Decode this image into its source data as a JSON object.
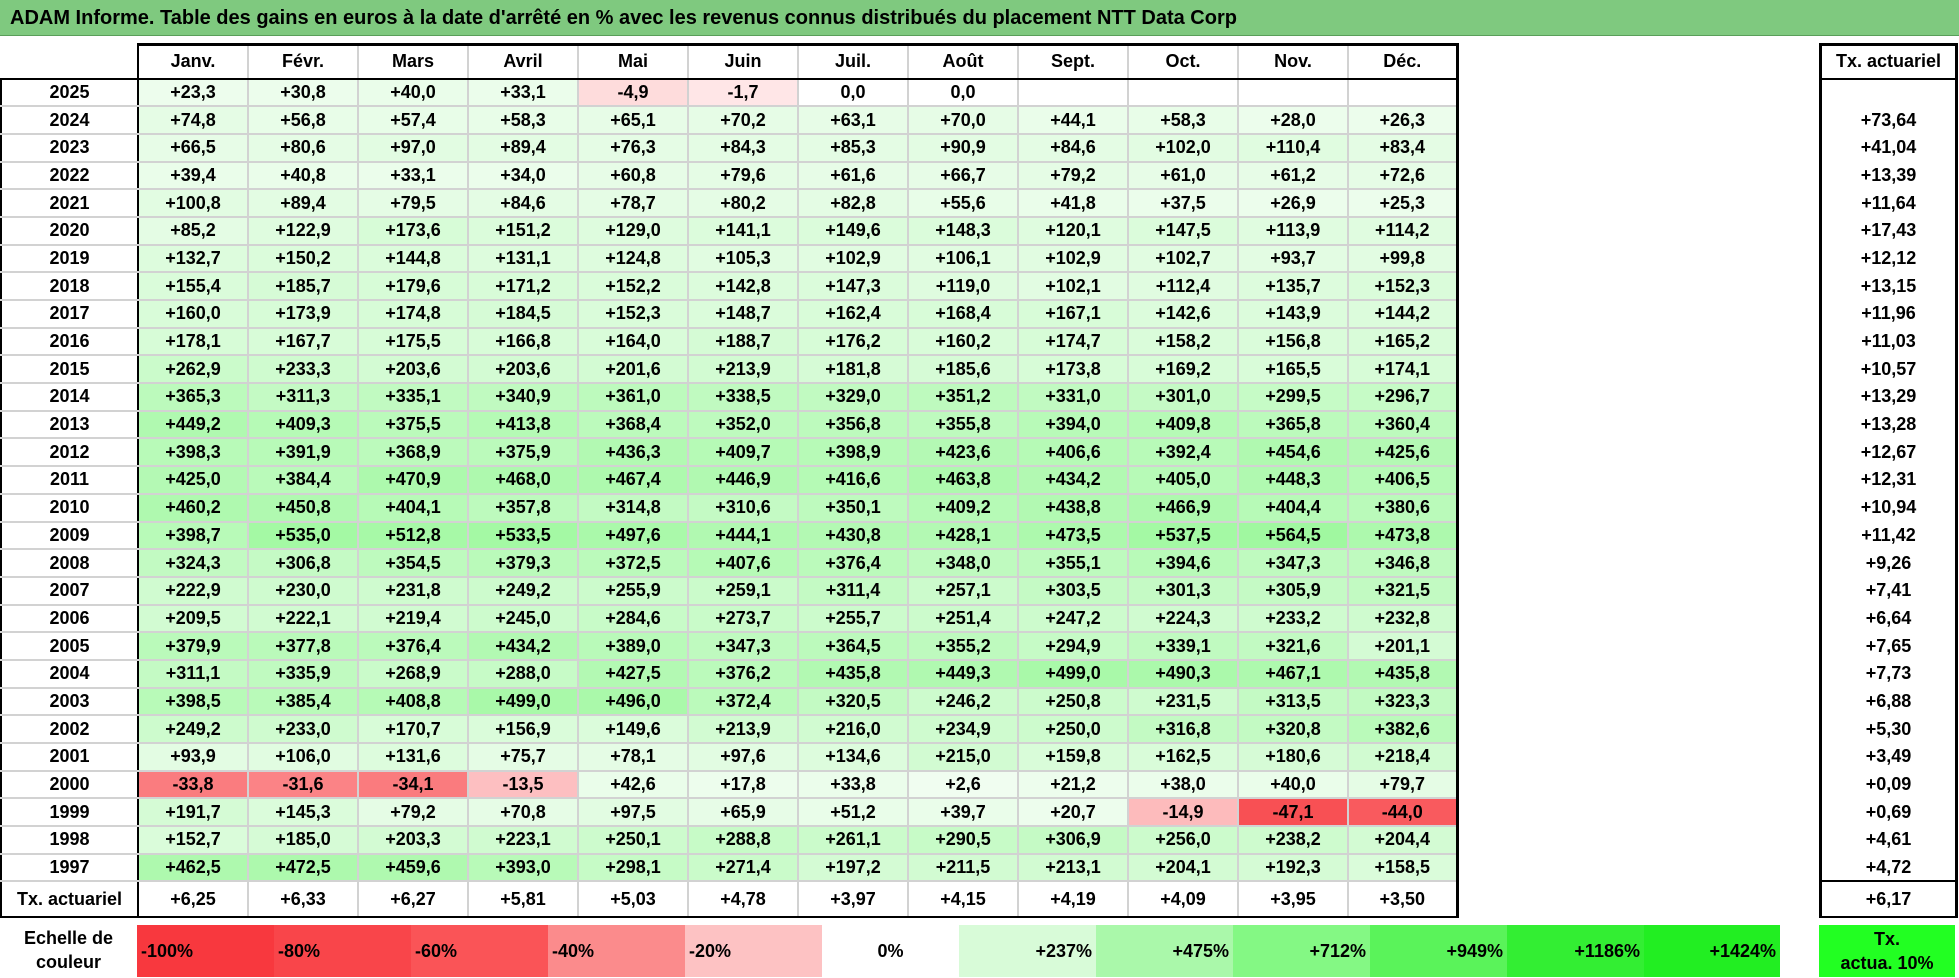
{
  "title": "ADAM Informe. Table des gains en euros à la date d'arrêté en % avec les revenus connus distribués du placement NTT Data Corp",
  "months": [
    "Janv.",
    "Févr.",
    "Mars",
    "Avril",
    "Mai",
    "Juin",
    "Juil.",
    "Août",
    "Sept.",
    "Oct.",
    "Nov.",
    "Déc."
  ],
  "act_header": "Tx. actuariel",
  "rows": [
    {
      "year": "2025",
      "vals": [
        "+23,3",
        "+30,8",
        "+40,0",
        "+33,1",
        "-4,9",
        "-1,7",
        "0,0",
        "0,0",
        "",
        "",
        "",
        ""
      ],
      "act": ""
    },
    {
      "year": "2024",
      "vals": [
        "+74,8",
        "+56,8",
        "+57,4",
        "+58,3",
        "+65,1",
        "+70,2",
        "+63,1",
        "+70,0",
        "+44,1",
        "+58,3",
        "+28,0",
        "+26,3"
      ],
      "act": "+73,64"
    },
    {
      "year": "2023",
      "vals": [
        "+66,5",
        "+80,6",
        "+97,0",
        "+89,4",
        "+76,3",
        "+84,3",
        "+85,3",
        "+90,9",
        "+84,6",
        "+102,0",
        "+110,4",
        "+83,4"
      ],
      "act": "+41,04"
    },
    {
      "year": "2022",
      "vals": [
        "+39,4",
        "+40,8",
        "+33,1",
        "+34,0",
        "+60,8",
        "+79,6",
        "+61,6",
        "+66,7",
        "+79,2",
        "+61,0",
        "+61,2",
        "+72,6"
      ],
      "act": "+13,39"
    },
    {
      "year": "2021",
      "vals": [
        "+100,8",
        "+89,4",
        "+79,5",
        "+84,6",
        "+78,7",
        "+80,2",
        "+82,8",
        "+55,6",
        "+41,8",
        "+37,5",
        "+26,9",
        "+25,3"
      ],
      "act": "+11,64"
    },
    {
      "year": "2020",
      "vals": [
        "+85,2",
        "+122,9",
        "+173,6",
        "+151,2",
        "+129,0",
        "+141,1",
        "+149,6",
        "+148,3",
        "+120,1",
        "+147,5",
        "+113,9",
        "+114,2"
      ],
      "act": "+17,43"
    },
    {
      "year": "2019",
      "vals": [
        "+132,7",
        "+150,2",
        "+144,8",
        "+131,1",
        "+124,8",
        "+105,3",
        "+102,9",
        "+106,1",
        "+102,9",
        "+102,7",
        "+93,7",
        "+99,8"
      ],
      "act": "+12,12"
    },
    {
      "year": "2018",
      "vals": [
        "+155,4",
        "+185,7",
        "+179,6",
        "+171,2",
        "+152,2",
        "+142,8",
        "+147,3",
        "+119,0",
        "+102,1",
        "+112,4",
        "+135,7",
        "+152,3"
      ],
      "act": "+13,15"
    },
    {
      "year": "2017",
      "vals": [
        "+160,0",
        "+173,9",
        "+174,8",
        "+184,5",
        "+152,3",
        "+148,7",
        "+162,4",
        "+168,4",
        "+167,1",
        "+142,6",
        "+143,9",
        "+144,2"
      ],
      "act": "+11,96"
    },
    {
      "year": "2016",
      "vals": [
        "+178,1",
        "+167,7",
        "+175,5",
        "+166,8",
        "+164,0",
        "+188,7",
        "+176,2",
        "+160,2",
        "+174,7",
        "+158,2",
        "+156,8",
        "+165,2"
      ],
      "act": "+11,03"
    },
    {
      "year": "2015",
      "vals": [
        "+262,9",
        "+233,3",
        "+203,6",
        "+203,6",
        "+201,6",
        "+213,9",
        "+181,8",
        "+185,6",
        "+173,8",
        "+169,2",
        "+165,5",
        "+174,1"
      ],
      "act": "+10,57"
    },
    {
      "year": "2014",
      "vals": [
        "+365,3",
        "+311,3",
        "+335,1",
        "+340,9",
        "+361,0",
        "+338,5",
        "+329,0",
        "+351,2",
        "+331,0",
        "+301,0",
        "+299,5",
        "+296,7"
      ],
      "act": "+13,29"
    },
    {
      "year": "2013",
      "vals": [
        "+449,2",
        "+409,3",
        "+375,5",
        "+413,8",
        "+368,4",
        "+352,0",
        "+356,8",
        "+355,8",
        "+394,0",
        "+409,8",
        "+365,8",
        "+360,4"
      ],
      "act": "+13,28"
    },
    {
      "year": "2012",
      "vals": [
        "+398,3",
        "+391,9",
        "+368,9",
        "+375,9",
        "+436,3",
        "+409,7",
        "+398,9",
        "+423,6",
        "+406,6",
        "+392,4",
        "+454,6",
        "+425,6"
      ],
      "act": "+12,67"
    },
    {
      "year": "2011",
      "vals": [
        "+425,0",
        "+384,4",
        "+470,9",
        "+468,0",
        "+467,4",
        "+446,9",
        "+416,6",
        "+463,8",
        "+434,2",
        "+405,0",
        "+448,3",
        "+406,5"
      ],
      "act": "+12,31"
    },
    {
      "year": "2010",
      "vals": [
        "+460,2",
        "+450,8",
        "+404,1",
        "+357,8",
        "+314,8",
        "+310,6",
        "+350,1",
        "+409,2",
        "+438,8",
        "+466,9",
        "+404,4",
        "+380,6"
      ],
      "act": "+10,94"
    },
    {
      "year": "2009",
      "vals": [
        "+398,7",
        "+535,0",
        "+512,8",
        "+533,5",
        "+497,6",
        "+444,1",
        "+430,8",
        "+428,1",
        "+473,5",
        "+537,5",
        "+564,5",
        "+473,8"
      ],
      "act": "+11,42"
    },
    {
      "year": "2008",
      "vals": [
        "+324,3",
        "+306,8",
        "+354,5",
        "+379,3",
        "+372,5",
        "+407,6",
        "+376,4",
        "+348,0",
        "+355,1",
        "+394,6",
        "+347,3",
        "+346,8"
      ],
      "act": "+9,26"
    },
    {
      "year": "2007",
      "vals": [
        "+222,9",
        "+230,0",
        "+231,8",
        "+249,2",
        "+255,9",
        "+259,1",
        "+311,4",
        "+257,1",
        "+303,5",
        "+301,3",
        "+305,9",
        "+321,5"
      ],
      "act": "+7,41"
    },
    {
      "year": "2006",
      "vals": [
        "+209,5",
        "+222,1",
        "+219,4",
        "+245,0",
        "+284,6",
        "+273,7",
        "+255,7",
        "+251,4",
        "+247,2",
        "+224,3",
        "+233,2",
        "+232,8"
      ],
      "act": "+6,64"
    },
    {
      "year": "2005",
      "vals": [
        "+379,9",
        "+377,8",
        "+376,4",
        "+434,2",
        "+389,0",
        "+347,3",
        "+364,5",
        "+355,2",
        "+294,9",
        "+339,1",
        "+321,6",
        "+201,1"
      ],
      "act": "+7,65"
    },
    {
      "year": "2004",
      "vals": [
        "+311,1",
        "+335,9",
        "+268,9",
        "+288,0",
        "+427,5",
        "+376,2",
        "+435,8",
        "+449,3",
        "+499,0",
        "+490,3",
        "+467,1",
        "+435,8"
      ],
      "act": "+7,73"
    },
    {
      "year": "2003",
      "vals": [
        "+398,5",
        "+385,4",
        "+408,8",
        "+499,0",
        "+496,0",
        "+372,4",
        "+320,5",
        "+246,2",
        "+250,8",
        "+231,5",
        "+313,5",
        "+323,3"
      ],
      "act": "+6,88"
    },
    {
      "year": "2002",
      "vals": [
        "+249,2",
        "+233,0",
        "+170,7",
        "+156,9",
        "+149,6",
        "+213,9",
        "+216,0",
        "+234,9",
        "+250,0",
        "+316,8",
        "+320,8",
        "+382,6"
      ],
      "act": "+5,30"
    },
    {
      "year": "2001",
      "vals": [
        "+93,9",
        "+106,0",
        "+131,6",
        "+75,7",
        "+78,1",
        "+97,6",
        "+134,6",
        "+215,0",
        "+159,8",
        "+162,5",
        "+180,6",
        "+218,4"
      ],
      "act": "+3,49"
    },
    {
      "year": "2000",
      "vals": [
        "-33,8",
        "-31,6",
        "-34,1",
        "-13,5",
        "+42,6",
        "+17,8",
        "+33,8",
        "+2,6",
        "+21,2",
        "+38,0",
        "+40,0",
        "+79,7"
      ],
      "act": "+0,09"
    },
    {
      "year": "1999",
      "vals": [
        "+191,7",
        "+145,3",
        "+79,2",
        "+70,8",
        "+97,5",
        "+65,9",
        "+51,2",
        "+39,7",
        "+20,7",
        "-14,9",
        "-47,1",
        "-44,0"
      ],
      "act": "+0,69"
    },
    {
      "year": "1998",
      "vals": [
        "+152,7",
        "+185,0",
        "+203,3",
        "+223,1",
        "+250,1",
        "+288,8",
        "+261,1",
        "+290,5",
        "+306,9",
        "+256,0",
        "+238,2",
        "+204,4"
      ],
      "act": "+4,61"
    },
    {
      "year": "1997",
      "vals": [
        "+462,5",
        "+472,5",
        "+459,6",
        "+393,0",
        "+298,1",
        "+271,4",
        "+197,2",
        "+211,5",
        "+213,1",
        "+204,1",
        "+192,3",
        "+158,5"
      ],
      "act": "+4,72"
    }
  ],
  "total_row": {
    "label": "Tx. actuariel",
    "vals": [
      "+6,25",
      "+6,33",
      "+6,27",
      "+5,81",
      "+5,03",
      "+4,78",
      "+3,97",
      "+4,15",
      "+4,19",
      "+4,09",
      "+3,95",
      "+3,50"
    ],
    "act": "+6,17"
  },
  "scale": {
    "label_line1": "Echelle de",
    "label_line2": "couleur",
    "items": [
      {
        "text": "-100%",
        "color": "#f8383e",
        "kind": "neg"
      },
      {
        "text": "-80%",
        "color": "#f9454a",
        "kind": "neg"
      },
      {
        "text": "-60%",
        "color": "#fa5457",
        "kind": "neg"
      },
      {
        "text": "-40%",
        "color": "#fb8b8c",
        "kind": "neg"
      },
      {
        "text": "-20%",
        "color": "#fdc2c3",
        "kind": "neg"
      },
      {
        "text": "0%",
        "color": "#ffffff",
        "kind": "zero"
      },
      {
        "text": "+237%",
        "color": "#d8fbd8",
        "kind": "pos"
      },
      {
        "text": "+475%",
        "color": "#aaf8aa",
        "kind": "pos"
      },
      {
        "text": "+712%",
        "color": "#84f884",
        "kind": "pos"
      },
      {
        "text": "+949%",
        "color": "#5af35a",
        "kind": "pos"
      },
      {
        "text": "+1186%",
        "color": "#33ee33",
        "kind": "pos"
      },
      {
        "text": "+1424%",
        "color": "#22ee22",
        "kind": "pos"
      }
    ],
    "act_line1": "Tx.",
    "act_line2": "actua. 10%",
    "act_color": "#22ff22"
  }
}
